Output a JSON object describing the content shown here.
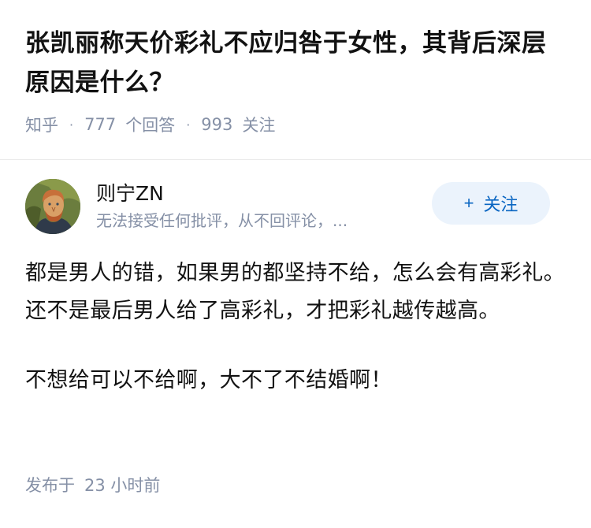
{
  "question": {
    "title": "张凯丽称天价彩礼不应归咎于女性，其背后深层原因是什么？",
    "source": "知乎",
    "answer_count": "777",
    "answer_label": "个回答",
    "follower_count": "993",
    "follower_label": "关注"
  },
  "author": {
    "name": "则宁ZN",
    "bio": "无法接受任何批评，从不回评论，...",
    "follow_plus": "+",
    "follow_label": "关注"
  },
  "answer": {
    "paragraphs": [
      "都是男人的错，如果男的都坚持不给，怎么会有高彩礼。还不是最后男人给了高彩礼，才把彩礼越传越高。",
      "不想给可以不给啊，大不了不结婚啊！"
    ],
    "time_prefix": "发布于",
    "time_value": "23 小时前"
  },
  "colors": {
    "text_primary": "#121212",
    "text_secondary": "#8590a6",
    "follow_bg": "#ebf3fc",
    "follow_text": "#0a66c2"
  },
  "icons": {
    "avatar": "portrait-avatar"
  }
}
